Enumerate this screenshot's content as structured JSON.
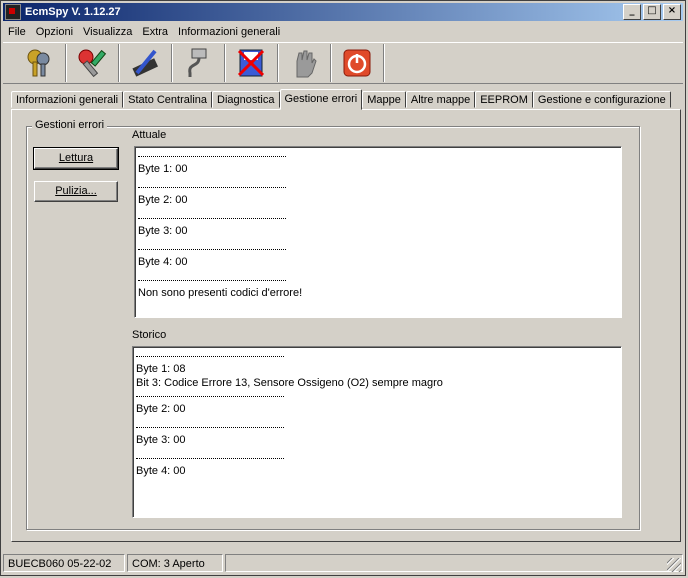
{
  "window": {
    "title": "EcmSpy V. 1.12.27",
    "min": "_",
    "max": "□",
    "close": "×"
  },
  "menu": [
    "File",
    "Opzioni",
    "Visualizza",
    "Extra",
    "Informazioni generali"
  ],
  "toolbar": [
    {
      "icon": "keys-icon"
    },
    {
      "icon": "tools-icon"
    },
    {
      "icon": "chip-pen-icon"
    },
    {
      "icon": "serial-cable-icon"
    },
    {
      "icon": "close-doc-icon"
    },
    {
      "icon": "glove-icon"
    },
    {
      "icon": "power-icon"
    }
  ],
  "tabs": [
    "Informazioni generali",
    "Stato Centralina",
    "Diagnostica",
    "Gestione errori",
    "Mappe",
    "Altre mappe",
    "EEPROM",
    "Gestione e configurazione"
  ],
  "active_tab": "Gestione errori",
  "group": {
    "label": "Gestioni errori",
    "read_button": "Lettura",
    "clear_button": "Pulizia..."
  },
  "attuale": {
    "label": "Attuale",
    "lines": [
      "Byte 1: 00",
      "Byte 2: 00",
      "Byte 3: 00",
      "Byte 4: 00",
      "Non sono presenti codici d'errore!"
    ]
  },
  "storico": {
    "label": "Storico",
    "byte1": "Byte 1: 08",
    "byte1_detail": "Bit 3: Codice Errore 13, Sensore Ossigeno (O2) sempre magro",
    "byte2": "Byte 2: 00",
    "byte3": "Byte 3: 00",
    "byte4": "Byte 4: 00"
  },
  "status": {
    "ecu": "BUECB060 05-22-02",
    "com": "COM: 3 Aperto"
  }
}
